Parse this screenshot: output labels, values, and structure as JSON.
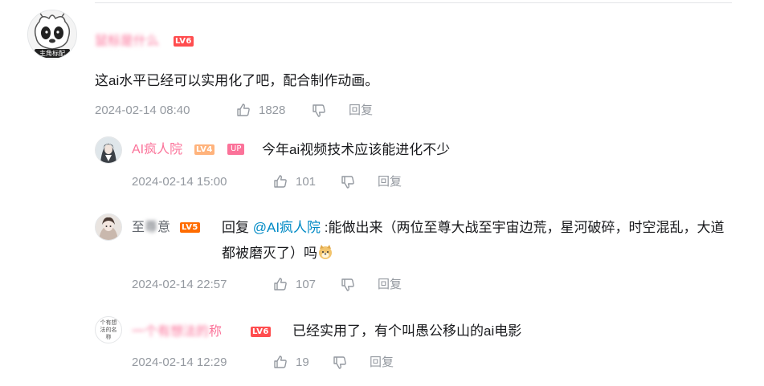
{
  "comments": [
    {
      "username": "鼠标是什么",
      "level": "LV6",
      "avatar_text": "主角标配",
      "content": "这ai水平已经可以实用化了吧，配合制作动画。",
      "time": "2024-02-14 08:40",
      "likes": "1828",
      "reply_label": "回复"
    },
    {
      "username": "AI疯人院",
      "level": "LV4",
      "badge": "UP",
      "content": "今年ai视频技术应该能进化不少",
      "time": "2024-02-14 15:00",
      "likes": "101",
      "reply_label": "回复"
    },
    {
      "username_visible_1": "至",
      "username_blurred": "尊",
      "username_visible_2": "意",
      "level": "LV5",
      "reply_prefix": "回复",
      "mention": "@AI疯人院",
      "content_rest": ":能做出来（两位至尊大战至宇宙边荒，星河破碎，时空混乱，大道都被磨灭了）吗",
      "emoji": "doge-emoji",
      "time": "2024-02-14 22:57",
      "likes": "107",
      "reply_label": "回复"
    },
    {
      "username_blurred": "一个有想法的",
      "username_visible": "称",
      "level": "LV6",
      "avatar_text": "个有想法的名称",
      "content": "已经实用了，有个叫愚公移山的ai电影",
      "time": "2024-02-14 12:29",
      "likes": "19",
      "reply_label": "回复"
    }
  ],
  "colors": {
    "pink": "#fb7299",
    "meta_gray": "#9499a0",
    "link_blue": "#008ac5",
    "lv6": "#ff4d4f",
    "lv5": "#ff6c00",
    "lv4": "#ffb37c"
  }
}
